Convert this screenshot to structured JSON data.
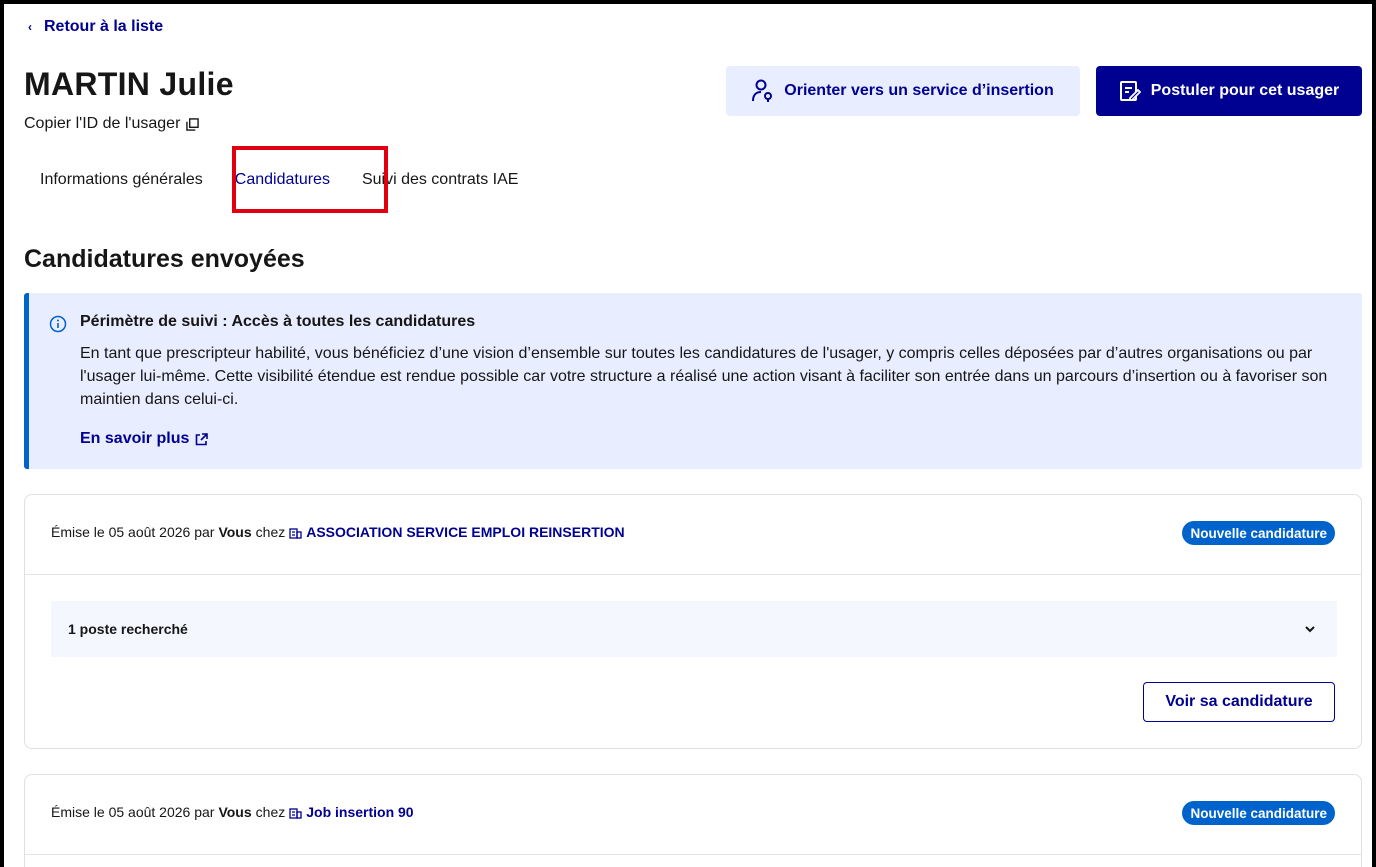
{
  "nav": {
    "back_label": "Retour à la liste"
  },
  "header": {
    "name": "MARTIN Julie",
    "copy_id_label": "Copier l'ID de l'usager",
    "orient_button": "Orienter vers un service d’insertion",
    "apply_button": "Postuler pour cet usager"
  },
  "tabs": [
    {
      "label": "Informations générales",
      "active": false
    },
    {
      "label": "Candidatures",
      "active": true
    },
    {
      "label": "Suivi des contrats IAE",
      "active": false
    }
  ],
  "section": {
    "title": "Candidatures envoyées"
  },
  "notice": {
    "title": "Périmètre de suivi : Accès à toutes les candidatures",
    "body": "En tant que prescripteur habilité, vous bénéficiez d’une vision d’ensemble sur toutes les candidatures de l'usager, y compris celles déposées par d’autres organisations ou par l'usager lui-même. Cette visibilité étendue est rendue possible car votre structure a réalisé une action visant à faciliter son entrée dans un parcours d’insertion ou à favoriser son maintien dans celui-ci.",
    "link": "En savoir plus"
  },
  "applications": [
    {
      "prefix": "Émise le 05 août 2026 par",
      "by": "Vous",
      "at": "chez",
      "org": "ASSOCIATION SERVICE EMPLOI REINSERTION",
      "status": "Nouvelle candidature",
      "positions": "1 poste recherché",
      "view_button": "Voir sa candidature"
    },
    {
      "prefix": "Émise le 05 août 2026 par",
      "by": "Vous",
      "at": "chez",
      "org": "Job insertion 90",
      "status": "Nouvelle candidature"
    }
  ],
  "colors": {
    "primary": "#000091",
    "info_bg": "#e8edff",
    "info_border": "#0063cb",
    "badge": "#0063cb",
    "highlight": "#e1000f"
  }
}
